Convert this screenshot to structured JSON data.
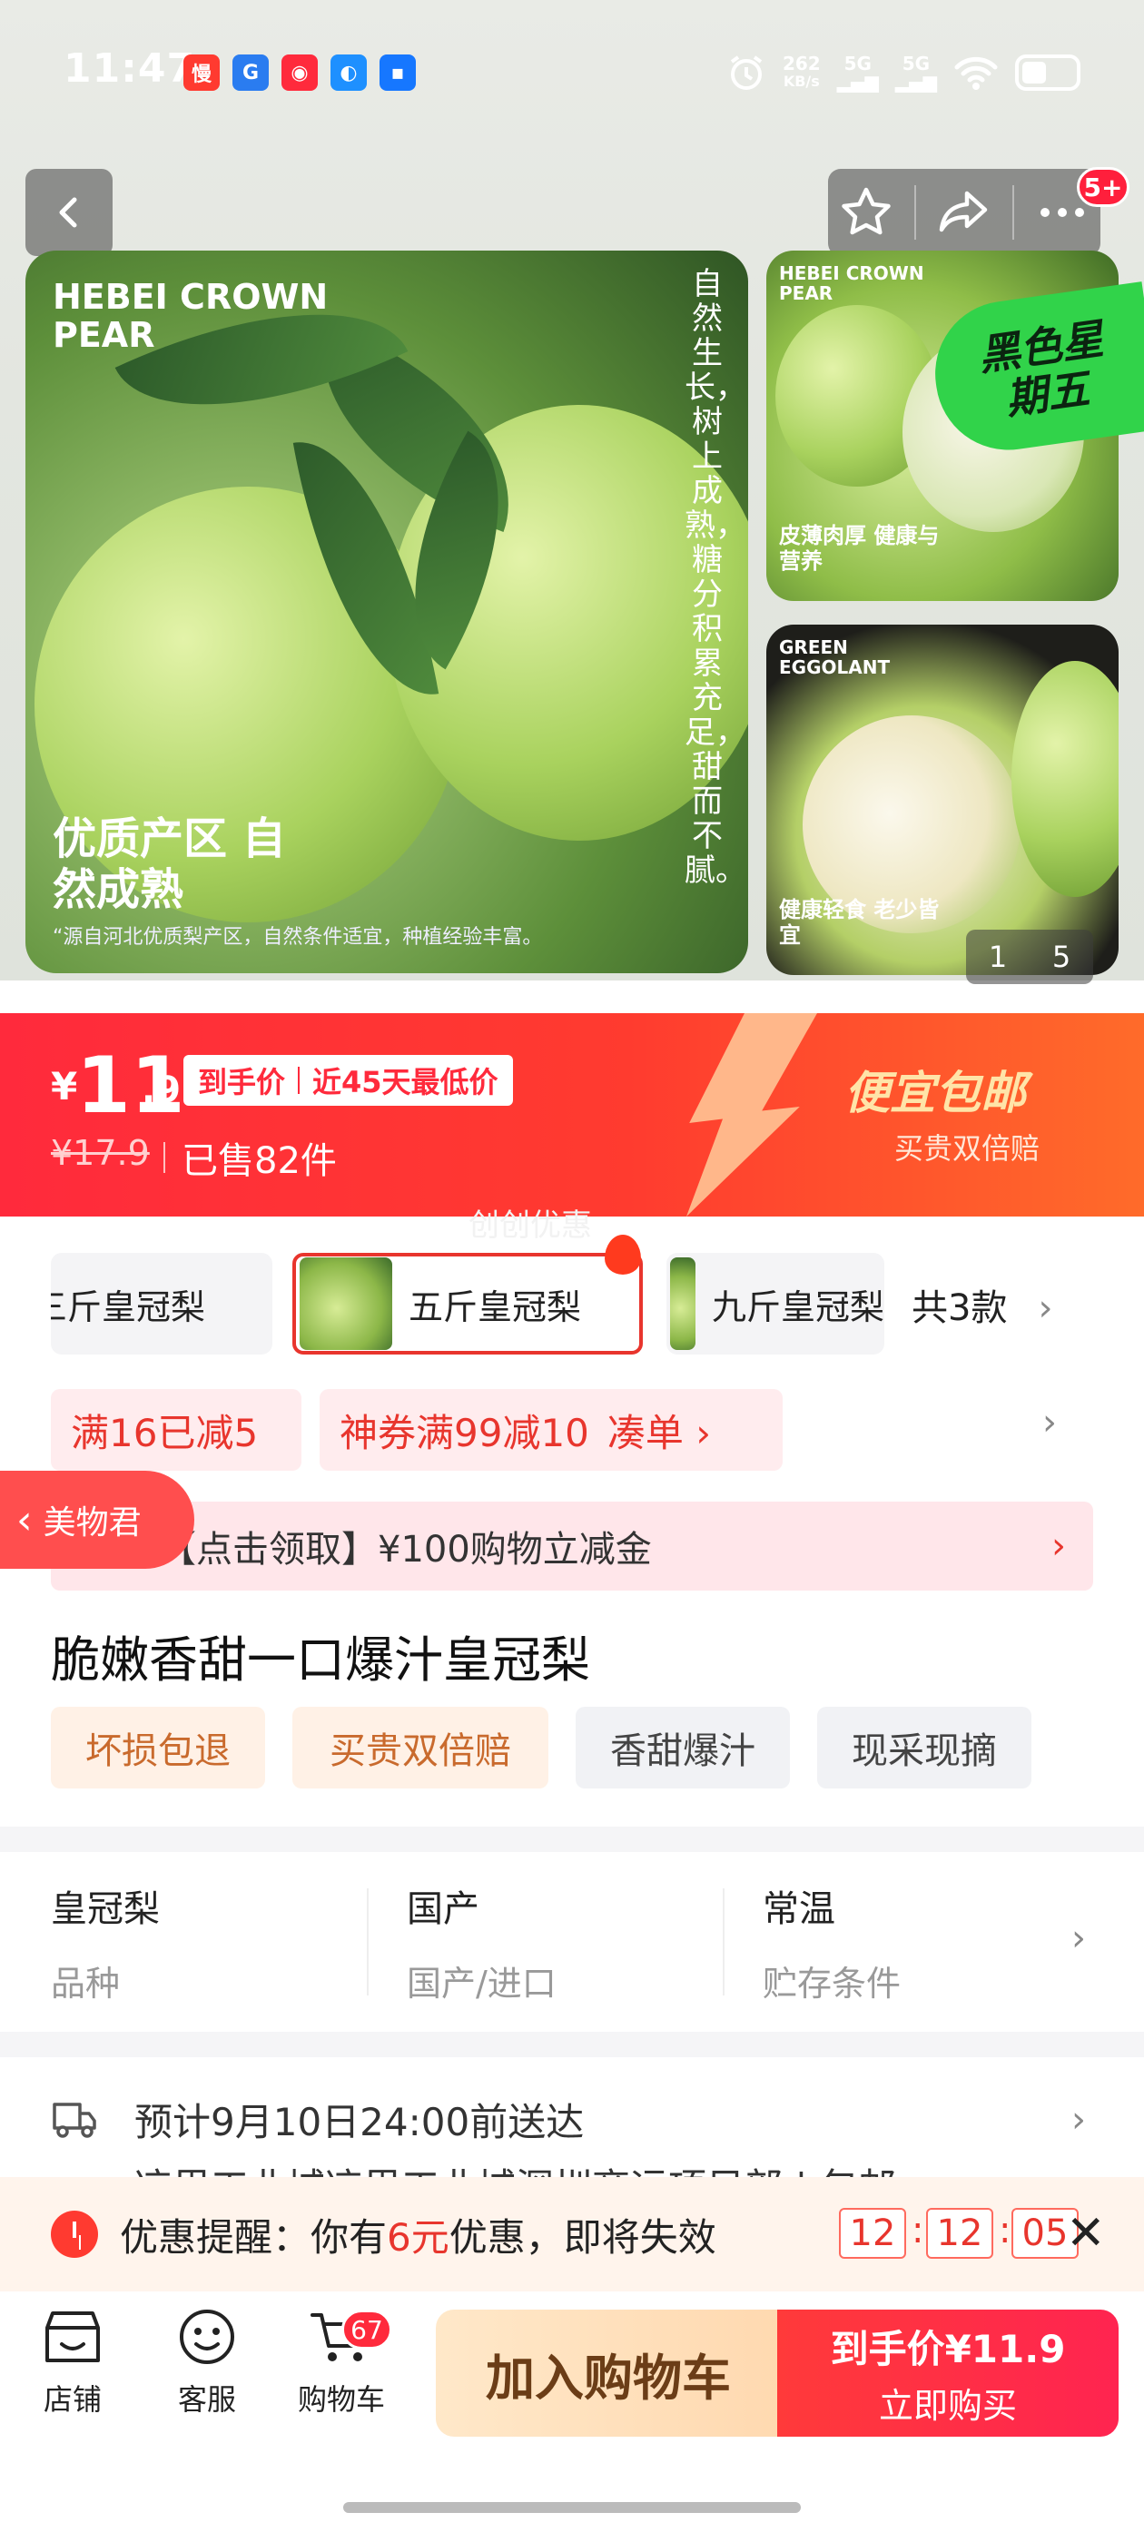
{
  "status_bar": {
    "time": "11:47",
    "net_speed": "262",
    "net_unit": "KB/s",
    "sig1": "5G",
    "sig2": "5G",
    "app_icons": [
      {
        "glyph": "慢",
        "color": "#ff3a30"
      },
      {
        "glyph": "G",
        "color": "#2a7cf0"
      },
      {
        "glyph": "◉",
        "color": "#ff2a3c"
      },
      {
        "glyph": "◐",
        "color": "#1e90ff"
      },
      {
        "glyph": "▪",
        "color": "#1677ff"
      }
    ]
  },
  "header": {
    "back_icon": "chevron-left-icon",
    "actions": [
      "star-icon",
      "share-icon",
      "more-icon"
    ],
    "notification_badge": "5+"
  },
  "gallery": {
    "main": {
      "title_en": "HEBEI CROWN PEAR",
      "vertical_text": "自然生长，树上成熟，糖分积累充足，甜而不腻。",
      "headline": "优质产区 自然成熟",
      "caption": "“源自河北优质梨产区，自然条件适宜，种植经验丰富。"
    },
    "thumb1": {
      "title_en": "HEBEI CROWN PEAR",
      "caption": "皮薄肉厚 健康与营养"
    },
    "thumb2": {
      "title_en": "GREEN EGGOLANT",
      "caption": "健康轻食 老少皆宜"
    },
    "promo_sticker": "黑色星期五",
    "pager_current": "1",
    "pager_total": "5"
  },
  "price_banner": {
    "currency": "¥",
    "price_int": "11",
    "price_dec": ".9",
    "tag_left": "到手价",
    "tag_right": "近45天最低价",
    "original_price": "¥17.9",
    "sold": "已售82件",
    "promo": "便宜包邮",
    "promo_sub": "买贵双倍赔",
    "accent_color": "#ff2a3c"
  },
  "watermark": "创创优惠",
  "variants": {
    "items": [
      "三斤皇冠梨",
      "五斤皇冠梨",
      "九斤皇冠梨"
    ],
    "selected": "五斤皇冠梨",
    "count": "共3款"
  },
  "coupons": {
    "c1": "满16已减5",
    "c2": "神券满99减10",
    "c2_action": "凑单 ›"
  },
  "floating_label": "美物君",
  "voucher": "【点击领取】¥100购物立减金",
  "product": {
    "title": "脆嫩香甜一口爆汁皇冠梨",
    "tags": [
      "坏损包退",
      "买贵双倍赔",
      "香甜爆汁",
      "现采现摘"
    ]
  },
  "specs": [
    {
      "value": "皇冠梨",
      "key": "品种"
    },
    {
      "value": "国产",
      "key": "国产/进口"
    },
    {
      "value": "常温",
      "key": "贮存条件"
    }
  ],
  "delivery": {
    "line1": "预计9月10日24:00前送达",
    "line2": "凉里工业城凉里工业城深圳商运项目部 | 包邮"
  },
  "reminder": {
    "prefix": "优惠提醒：你有",
    "amount": "6元",
    "suffix": "优惠，即将失效",
    "h": "12",
    "m": "12",
    "s": "05"
  },
  "bottom_bar": {
    "shop": "店铺",
    "service": "客服",
    "cart": "购物车",
    "cart_badge": "67",
    "add_to_cart": "加入购物车",
    "buy_price": "到手价¥11.9",
    "buy_now": "立即购买"
  }
}
